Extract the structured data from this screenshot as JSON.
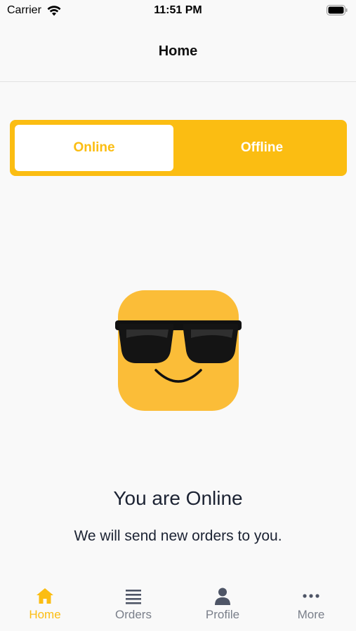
{
  "status_bar": {
    "carrier": "Carrier",
    "time": "11:51 PM"
  },
  "nav": {
    "title": "Home"
  },
  "toggle": {
    "online_label": "Online",
    "offline_label": "Offline",
    "selected": "Online"
  },
  "status": {
    "title": "You are Online",
    "subtitle": "We will send new orders to you."
  },
  "tabbar": {
    "items": [
      {
        "label": "Home",
        "icon": "home-icon",
        "active": true
      },
      {
        "label": "Orders",
        "icon": "list-icon",
        "active": false
      },
      {
        "label": "Profile",
        "icon": "person-icon",
        "active": false
      },
      {
        "label": "More",
        "icon": "more-dots-icon",
        "active": false
      }
    ]
  },
  "colors": {
    "accent": "#fbbd12",
    "text": "#1c2333",
    "inactive": "#7a7f8a",
    "background": "#f9f9f9"
  }
}
